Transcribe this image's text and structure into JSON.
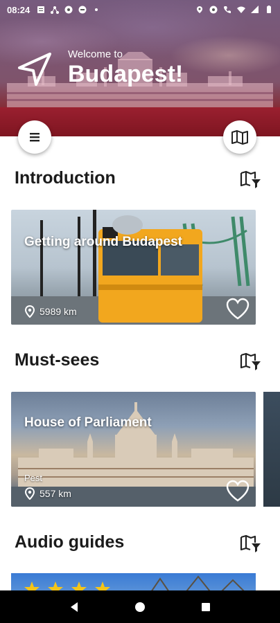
{
  "status_bar": {
    "time": "08:24",
    "left_icons": [
      "message-icon",
      "network-icon",
      "app-icon",
      "app-icon-2",
      "dot-icon"
    ],
    "right_icons": [
      "location-icon",
      "eye-icon",
      "phone-icon",
      "wifi-icon",
      "lte-signal-icon",
      "battery-icon"
    ]
  },
  "header": {
    "welcome": "Welcome to",
    "city": "Budapest!"
  },
  "sections": [
    {
      "title": "Introduction",
      "cards": [
        {
          "title": "Getting around Budapest",
          "distance": "5989 km",
          "favorite": false
        }
      ]
    },
    {
      "title": "Must-sees",
      "cards": [
        {
          "title": "House of Parliament",
          "subtitle": "Pest",
          "distance": "557 km",
          "favorite": false
        }
      ]
    },
    {
      "title": "Audio guides",
      "cards": []
    }
  ],
  "colors": {
    "accent": "#8c1420",
    "text": "#1b1b1b",
    "card_text": "#ffffff"
  }
}
